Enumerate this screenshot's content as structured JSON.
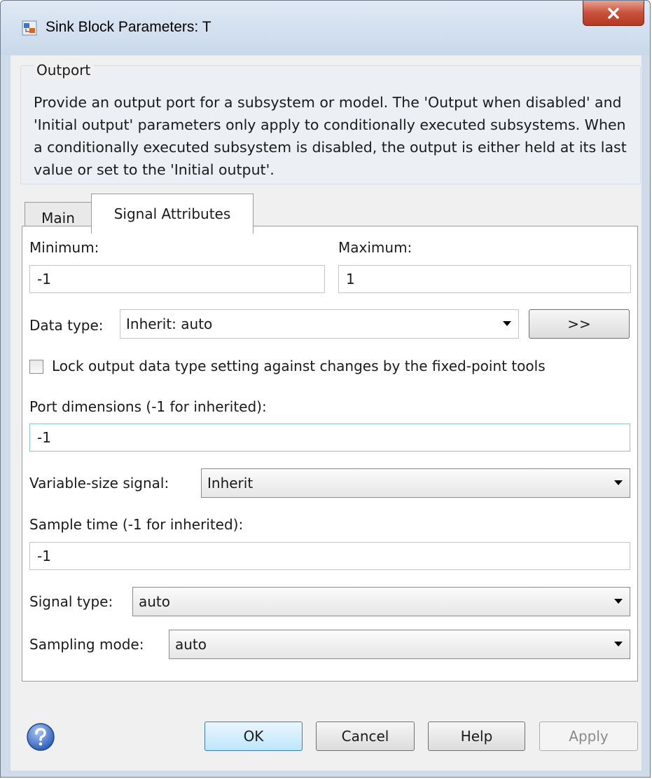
{
  "window": {
    "title": "Sink Block Parameters: T",
    "close_label": "X"
  },
  "description": {
    "group_title": "Outport",
    "text": "Provide an output port for a subsystem or model.  The 'Output when disabled' and 'Initial output' parameters only apply to conditionally executed subsystems. When a conditionally executed subsystem is disabled, the output is either held at its last value or set to the 'Initial output'."
  },
  "tabs": [
    {
      "label": "Main",
      "active": false
    },
    {
      "label": "Signal Attributes",
      "active": true
    }
  ],
  "form": {
    "minimum_label": "Minimum:",
    "minimum_value": "-1",
    "maximum_label": "Maximum:",
    "maximum_value": "1",
    "data_type_label": "Data type:",
    "data_type_value": "Inherit: auto",
    "data_type_assistant_label": ">>",
    "lock_label": "Lock output data type setting against changes by the fixed-point tools",
    "lock_checked": false,
    "port_dimensions_label": "Port dimensions (-1 for inherited):",
    "port_dimensions_value": "-1",
    "variable_size_label": "Variable-size signal:",
    "variable_size_value": "Inherit",
    "sample_time_label": "Sample time (-1 for inherited):",
    "sample_time_value": "-1",
    "signal_type_label": "Signal type:",
    "signal_type_value": "auto",
    "sampling_mode_label": "Sampling mode:",
    "sampling_mode_value": "auto"
  },
  "buttons": {
    "ok": "OK",
    "cancel": "Cancel",
    "help": "Help",
    "apply": "Apply"
  },
  "icons": {
    "app": "simulink-block-icon",
    "help": "help-question-icon",
    "close": "close-icon"
  },
  "colors": {
    "close_button": "#c9503a",
    "default_button": "#bde6fd",
    "focus_border": "#8fc1e6"
  }
}
